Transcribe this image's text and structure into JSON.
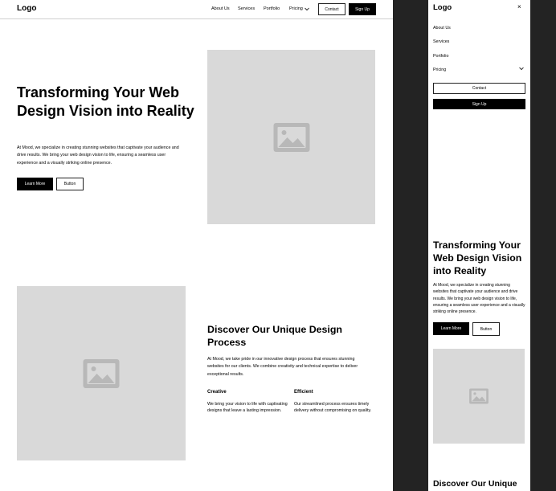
{
  "desktop": {
    "nav": {
      "logo": "Logo",
      "links": [
        "About Us",
        "Services",
        "Portfolio",
        "Pricing"
      ],
      "contact_label": "Contact",
      "signup_label": "Sign Up"
    },
    "hero": {
      "heading": "Transforming Your Web Design Vision into Reality",
      "body": "At Mood, we specialize in creating stunning websites that captivate your audience and drive results. We bring your web design vision to life, ensuring a seamless user experience and a visually striking online presence.",
      "primary_label": "Learn More",
      "secondary_label": "Button"
    },
    "process": {
      "heading": "Discover Our Unique Design Process",
      "body": "At Mood, we take pride in our innovative design process that ensures stunning websites for our clients. We combine creativity and technical expertise to deliver exceptional results.",
      "features": [
        {
          "title": "Creative",
          "text": "We bring your vision to life with captivating designs that leave a lasting impression."
        },
        {
          "title": "Efficient",
          "text": "Our streamlined process ensures timely delivery without compromising on quality."
        }
      ]
    }
  },
  "mobile": {
    "logo": "Logo",
    "close_glyph": "×",
    "menu": [
      "About Us",
      "Services",
      "Portfolio",
      "Pricing"
    ],
    "contact_label": "Contact",
    "signup_label": "Sign Up",
    "hero": {
      "heading": "Transforming Your Web Design Vision into Reality",
      "body": "At Mood, we specialize in creating stunning websites that captivate your audience and drive results. We bring your web design vision to life, ensuring a seamless user experience and a visually striking online presence.",
      "primary_label": "Learn More",
      "secondary_label": "Button"
    },
    "next_heading": "Discover Our Unique"
  },
  "colors": {
    "placeholder": "#d9d9d9",
    "icon": "#b8b8b8",
    "canvas": "#232323",
    "accent": "#000000"
  },
  "icons": {
    "image": "image-placeholder-icon",
    "chevron": "chevron-down-icon",
    "close": "close-icon"
  }
}
